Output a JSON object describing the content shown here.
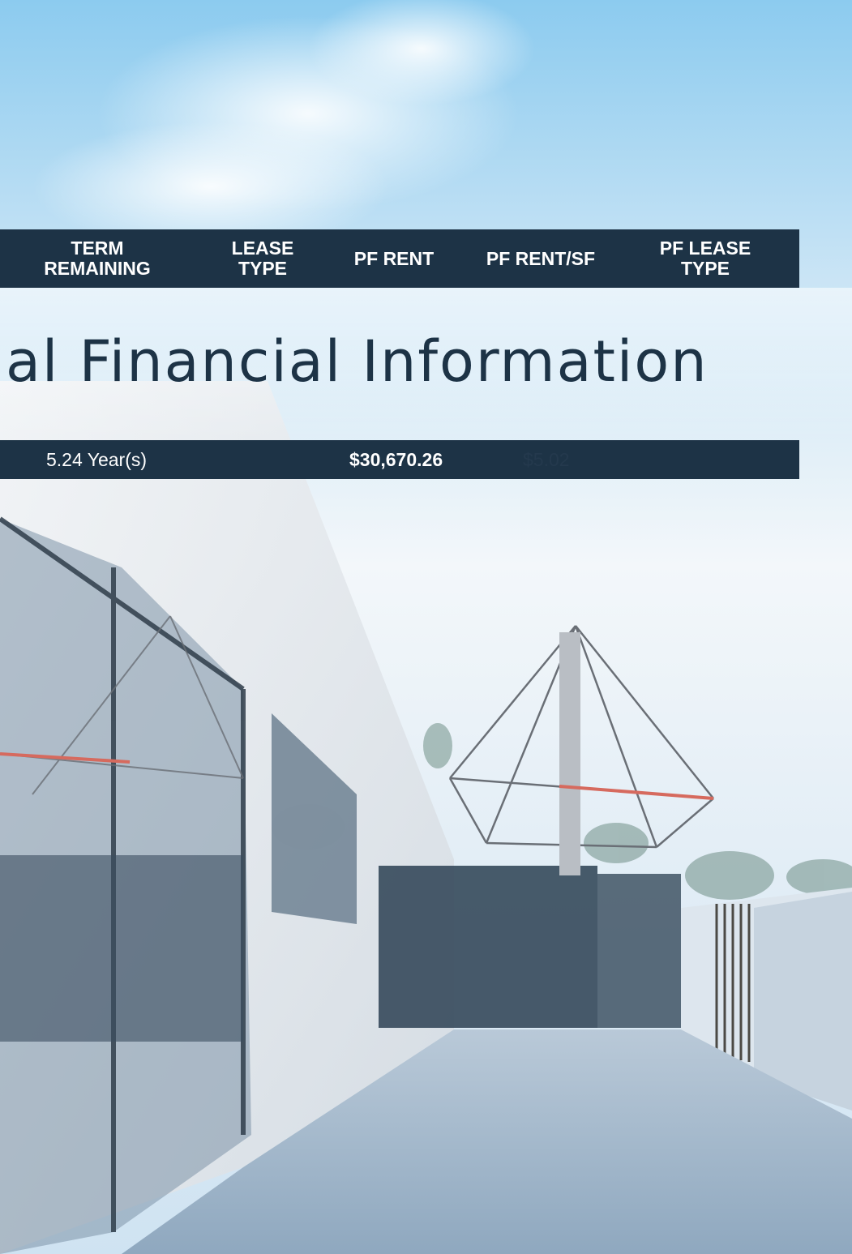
{
  "table": {
    "headers": [
      "TERM\nREMAINING",
      "LEASE\nTYPE",
      "PF RENT",
      "PF RENT/SF",
      "PF LEASE\nTYPE"
    ],
    "row": {
      "term_remaining": "5.24 Year(s)",
      "lease_type": "",
      "pf_rent": "$30,670.26",
      "pf_rent_sf": "$5.02",
      "pf_lease_type": ""
    }
  },
  "section": {
    "title": "al Financial Information"
  },
  "colors": {
    "band": "#1d3346",
    "sky_top": "#8fcbef",
    "sky_light": "#f4f8fb",
    "text_light": "#ffffff"
  }
}
